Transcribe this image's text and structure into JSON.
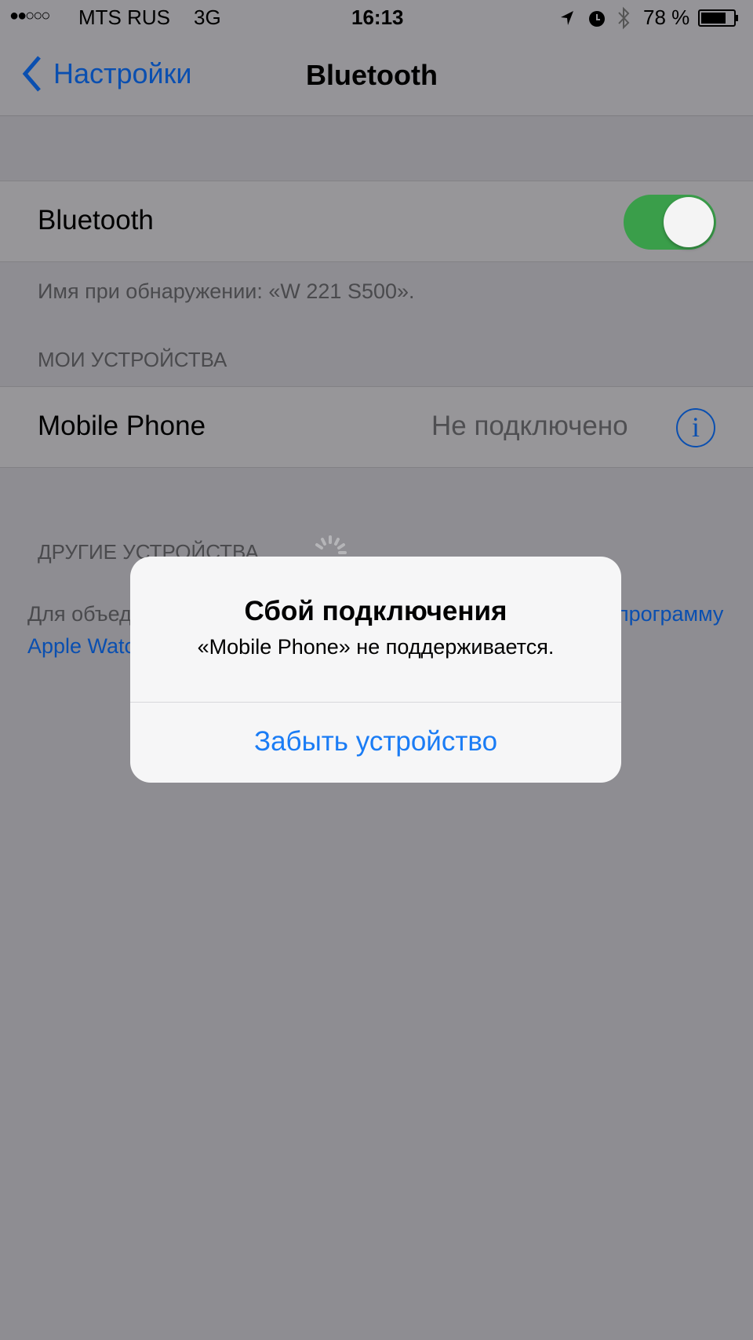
{
  "status_bar": {
    "signal_dots": "●●○○○",
    "carrier": "MTS RUS",
    "network": "3G",
    "time": "16:13",
    "battery_percent": "78 %",
    "battery_level": 0.78,
    "icons": [
      "location-arrow-icon",
      "alarm-icon",
      "bluetooth-icon",
      "battery-icon"
    ]
  },
  "nav": {
    "back_label": "Настройки",
    "title": "Bluetooth"
  },
  "bluetooth_row": {
    "label": "Bluetooth",
    "toggle_on": true,
    "toggle_color": "#4cd964"
  },
  "discovery_text": "Имя при обнаружении: «W 221 S500».",
  "my_devices": {
    "header": "МОИ УСТРОЙСТВА",
    "items": [
      {
        "name": "Mobile Phone",
        "status": "Не подключено"
      }
    ]
  },
  "other_devices": {
    "header": "ДРУГИЕ УСТРОЙСТВА",
    "footer_text": "Для объединения в пару Apple Watch с iPhone используйте",
    "footer_link": "программу Apple Watch."
  },
  "alert": {
    "title": "Сбой подключения",
    "message": "«Mobile Phone» не поддерживается.",
    "button": "Забыть устройство"
  },
  "colors": {
    "accent": "#0a4fb0",
    "alert_button": "#1a7cf5"
  }
}
